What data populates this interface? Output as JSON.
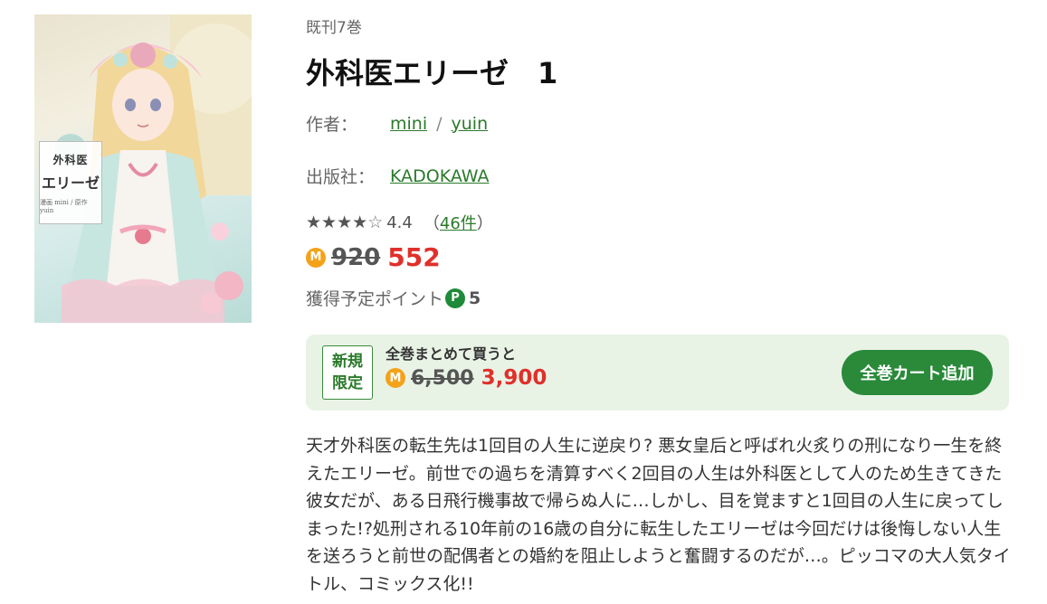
{
  "book": {
    "volumes": "既刊7巻",
    "title": "外科医エリーゼ　1",
    "author_label": "作者：",
    "authors": [
      "mini",
      "yuin"
    ],
    "author_sep": "/",
    "publisher_label": "出版社：",
    "publisher": "KADOKAWA",
    "cover": {
      "title_small": "外科医",
      "title_main": "エリーゼ",
      "credit": "漫画 mini / 原作 yuin"
    }
  },
  "rating": {
    "stars_filled": 4,
    "stars_total": 5,
    "score": "4.4",
    "count_open": "（",
    "count": "46件",
    "count_close": "）"
  },
  "price": {
    "coin_icon": "M",
    "original": "920",
    "sale": "552",
    "points_label": "獲得予定ポイント",
    "points_icon": "P",
    "points": "5"
  },
  "bundle": {
    "badge_line1": "新規",
    "badge_line2": "限定",
    "label": "全巻まとめて買うと",
    "coin_icon": "M",
    "original": "6,500",
    "sale": "3,900",
    "button": "全巻カート追加"
  },
  "description": "天才外科医の転生先は1回目の人生に逆戻り? 悪女皇后と呼ばれ火炙りの刑になり一生を終えたエリーゼ。前世での過ちを清算すべく2回目の人生は外科医として人のため生きてきた彼女だが、ある日飛行機事故で帰らぬ人に…しかし、目を覚ますと1回目の人生に戻ってしまった!?処刑される10年前の16歳の自分に転生したエリーゼは今回だけは後悔しない人生を送ろうと前世の配偶者との婚約を阻止しようと奮闘するのだが…。ピッコマの大人気タイトル、コミックス化!!",
  "colors": {
    "accent_green": "#2a8a3a",
    "sale_red": "#e0302b",
    "coin_orange": "#f4a21a",
    "bundle_bg": "#e8f3e6"
  }
}
